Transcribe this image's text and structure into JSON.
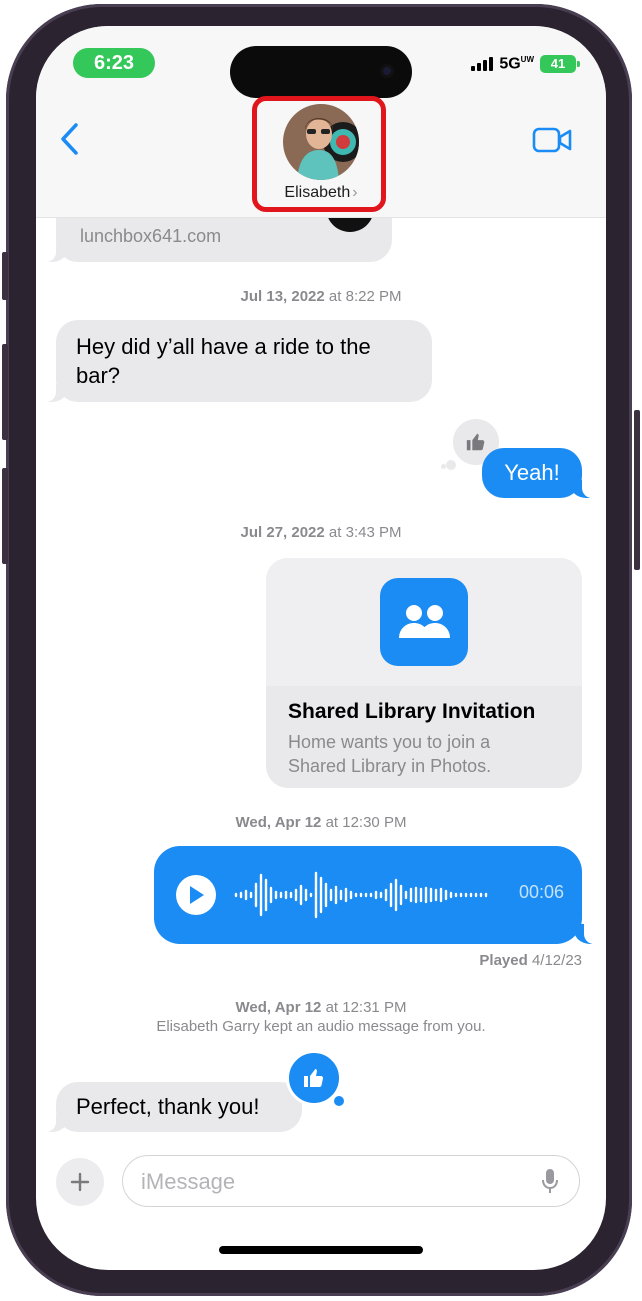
{
  "status_bar": {
    "time": "6:23",
    "network": "5G",
    "network_sup": "UW",
    "battery": "41"
  },
  "header": {
    "contact_name": "Elisabeth",
    "chevron": "›",
    "back_icon": "chevron-left-icon",
    "video_icon": "video-camera-icon",
    "highlight_color": "#e0161c"
  },
  "messages": {
    "link_preview_url": "lunchbox641.com",
    "stamp1": {
      "date": "Jul 13, 2022",
      "time": "at 8:22 PM"
    },
    "msg_ride": "Hey did y’all have a ride to the bar?",
    "msg_yeah": "Yeah!",
    "stamp2": {
      "date": "Jul 27, 2022",
      "time": "at 3:43 PM"
    },
    "shared_card": {
      "title": "Shared Library Invitation",
      "subtitle": "Home wants you to join a Shared Library in Photos."
    },
    "stamp3": {
      "date": "Wed, Apr 12",
      "time": "at 12:30 PM"
    },
    "audio": {
      "duration": "00:06"
    },
    "played": {
      "label": "Played",
      "date": "4/12/23"
    },
    "stamp4": {
      "date": "Wed, Apr 12",
      "time": "at 12:31 PM",
      "note": "Elisabeth Garry kept an audio message from you."
    },
    "msg_perfect": "Perfect, thank you!"
  },
  "compose": {
    "placeholder": "iMessage",
    "plus_icon": "plus-icon",
    "mic_icon": "microphone-icon"
  },
  "colors": {
    "blue": "#1a8cf3",
    "received": "#e9e9eb",
    "green": "#34c759"
  }
}
